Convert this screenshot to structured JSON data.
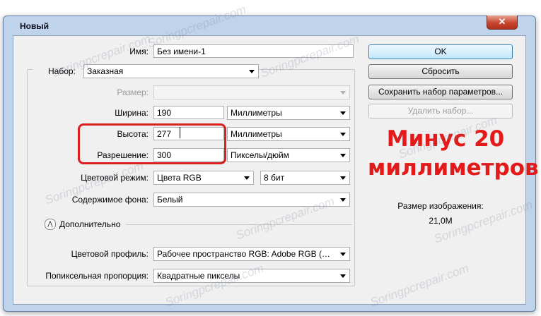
{
  "window": {
    "title": "Новый",
    "close_glyph": "✕"
  },
  "fields": {
    "name": {
      "label": "Имя:",
      "value": "Без имени-1"
    },
    "preset": {
      "label": "Набор:",
      "value": "Заказная"
    },
    "size": {
      "label": "Размер:",
      "value": ""
    },
    "width": {
      "label": "Ширина:",
      "value": "190",
      "unit": "Миллиметры"
    },
    "height": {
      "label": "Высота:",
      "value": "277",
      "unit": "Миллиметры"
    },
    "resolution": {
      "label": "Разрешение:",
      "value": "300",
      "unit": "Пикселы/дюйм"
    },
    "color_mode": {
      "label": "Цветовой режим:",
      "value": "Цвета RGB",
      "depth": "8 бит"
    },
    "background": {
      "label": "Содержимое фона:",
      "value": "Белый"
    },
    "advanced": {
      "label": "Дополнительно"
    },
    "color_profile": {
      "label": "Цветовой профиль:",
      "value": "Рабочее пространство RGB:  Adobe RGB (…"
    },
    "pixel_aspect": {
      "label": "Попиксельная пропорция:",
      "value": "Квадратные пикселы"
    }
  },
  "buttons": {
    "ok": "OK",
    "reset": "Сбросить",
    "save_preset": "Сохранить набор параметров...",
    "delete_preset": "Удалить набор..."
  },
  "image_size": {
    "label": "Размер изображения:",
    "value": "21,0M"
  },
  "annotation": {
    "line1": "Минус 20",
    "line2": "миллиметров"
  },
  "watermark": "Soringpcrepair.com",
  "colors": {
    "highlight": "#d91f1f",
    "annotation": "#e41919",
    "frame": "#bfd3ea"
  }
}
